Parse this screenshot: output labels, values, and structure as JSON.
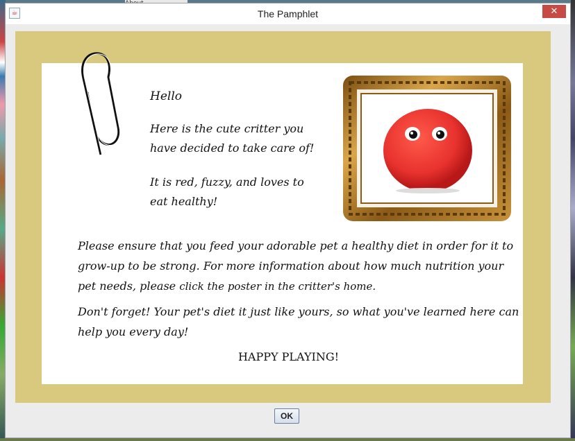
{
  "window": {
    "title": "The Pamphlet",
    "close_glyph": "✕"
  },
  "desktop": {
    "peek_text": "About"
  },
  "pamphlet": {
    "greeting": "Hello",
    "intro": "Here is the cute critter you have decided to take care of!",
    "traits": "It is red, fuzzy, and loves to eat healthy!",
    "paragraph1_text": "Please ensure that you feed your adorable pet a healthy diet in order for it to grow-up to be strong. For more information about how much nutrition your pet needs, please ",
    "paragraph1_link": "click the poster in the critter's home.",
    "paragraph2": "Don't forget! Your pet's diet it just like yours, so what you've learned here can help you every day!",
    "closing": "HAPPY PLAYING!"
  },
  "buttons": {
    "ok_label": "OK"
  },
  "colors": {
    "panel": "#d8c97e",
    "paper": "#ffffff",
    "close": "#c84a44",
    "critter": "#e8322e",
    "frame_gold": "#b8861f"
  },
  "icons": {
    "paperclip": "paperclip-icon",
    "critter": "critter-picture"
  }
}
